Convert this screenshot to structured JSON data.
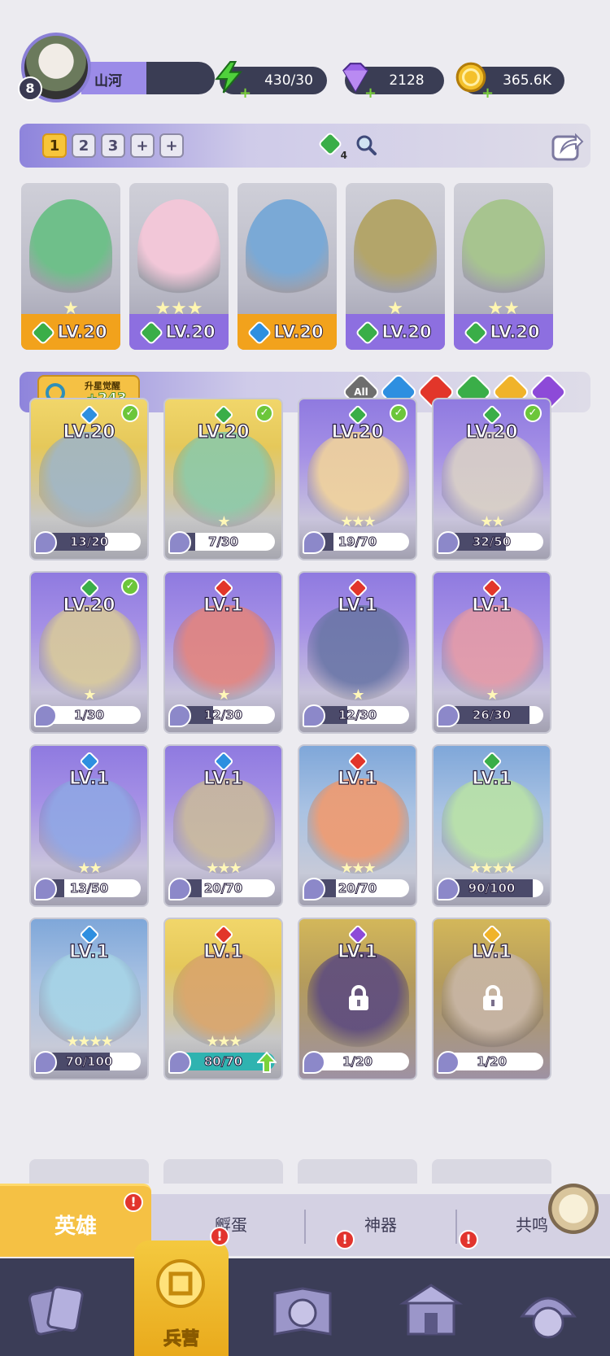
{
  "player": {
    "level": "8",
    "name": "山河"
  },
  "resources": {
    "energy": "430/30",
    "gems": "2128",
    "coins": "365.6K"
  },
  "team_bar": {
    "tabs": [
      "1",
      "2",
      "3",
      "+",
      "+"
    ],
    "gem_count": "4"
  },
  "lineup": [
    {
      "level": "LV.20",
      "stars": "★",
      "element": "green",
      "strip": "#f2a21c"
    },
    {
      "level": "LV.20",
      "stars": "★★★",
      "element": "green",
      "strip": "#8d6fe0"
    },
    {
      "level": "LV.20",
      "stars": "",
      "element": "blue",
      "strip": "#f2a21c"
    },
    {
      "level": "LV.20",
      "stars": "★",
      "element": "green",
      "strip": "#8d6fe0"
    },
    {
      "level": "LV.20",
      "stars": "★★",
      "element": "green",
      "strip": "#8d6fe0"
    }
  ],
  "filter_bar": {
    "awaken_label": "升星觉醒",
    "awaken_value": "+243",
    "filters": [
      "All",
      "water",
      "fire",
      "wind",
      "light",
      "dark"
    ]
  },
  "colors": {
    "water": "#2e8fe0",
    "fire": "#e2362a",
    "wind": "#3aae48",
    "light": "#f0b32a",
    "dark": "#8d4ad8"
  },
  "heroes": [
    {
      "level": "LV.20",
      "element": "water",
      "stars": "",
      "progress": "13/20",
      "pct": 0.65,
      "check": true,
      "style": "gold"
    },
    {
      "level": "LV.20",
      "element": "wind",
      "stars": "★",
      "progress": "7/30",
      "pct": 0.23,
      "check": true,
      "style": "gold"
    },
    {
      "level": "LV.20",
      "element": "wind",
      "stars": "★★★",
      "progress": "19/70",
      "pct": 0.27,
      "check": true,
      "style": "purple"
    },
    {
      "level": "LV.20",
      "element": "wind",
      "stars": "★★",
      "progress": "32/50",
      "pct": 0.64,
      "check": true,
      "style": "purple"
    },
    {
      "level": "LV.20",
      "element": "wind",
      "stars": "★",
      "progress": "1/30",
      "pct": 0.03,
      "check": true,
      "style": "purple"
    },
    {
      "level": "LV.1",
      "element": "fire",
      "stars": "★",
      "progress": "12/30",
      "pct": 0.4,
      "check": false,
      "style": "purple"
    },
    {
      "level": "LV.1",
      "element": "fire",
      "stars": "★",
      "progress": "12/30",
      "pct": 0.4,
      "check": false,
      "style": "purple"
    },
    {
      "level": "LV.1",
      "element": "fire",
      "stars": "★",
      "progress": "26/30",
      "pct": 0.87,
      "check": false,
      "style": "purple"
    },
    {
      "level": "LV.1",
      "element": "water",
      "stars": "★★",
      "progress": "13/50",
      "pct": 0.26,
      "check": false,
      "style": "purple"
    },
    {
      "level": "LV.1",
      "element": "water",
      "stars": "★★★",
      "progress": "20/70",
      "pct": 0.29,
      "check": false,
      "style": "purple"
    },
    {
      "level": "LV.1",
      "element": "fire",
      "stars": "★★★",
      "progress": "20/70",
      "pct": 0.29,
      "check": false,
      "style": "blue"
    },
    {
      "level": "LV.1",
      "element": "wind",
      "stars": "★★★★",
      "progress": "90/100",
      "pct": 0.9,
      "check": false,
      "style": "blue"
    },
    {
      "level": "LV.1",
      "element": "water",
      "stars": "★★★★",
      "progress": "70/100",
      "pct": 0.7,
      "check": false,
      "style": "blue"
    },
    {
      "level": "LV.1",
      "element": "fire",
      "stars": "★★★",
      "progress": "80/70",
      "pct": 1.0,
      "check": false,
      "style": "gold",
      "upgrade": true
    },
    {
      "level": "LV.1",
      "element": "dark",
      "stars": "",
      "progress": "1/20",
      "pct": 0.05,
      "check": false,
      "style": "locked",
      "locked": true
    },
    {
      "level": "LV.1",
      "element": "light",
      "stars": "",
      "progress": "1/20",
      "pct": 0.05,
      "check": false,
      "style": "locked",
      "locked": true
    }
  ],
  "sub_tabs": [
    "英雄",
    "孵蛋",
    "神器",
    "共鸣"
  ],
  "bottom_nav": {
    "active_label": "兵营",
    "badge": "!"
  }
}
